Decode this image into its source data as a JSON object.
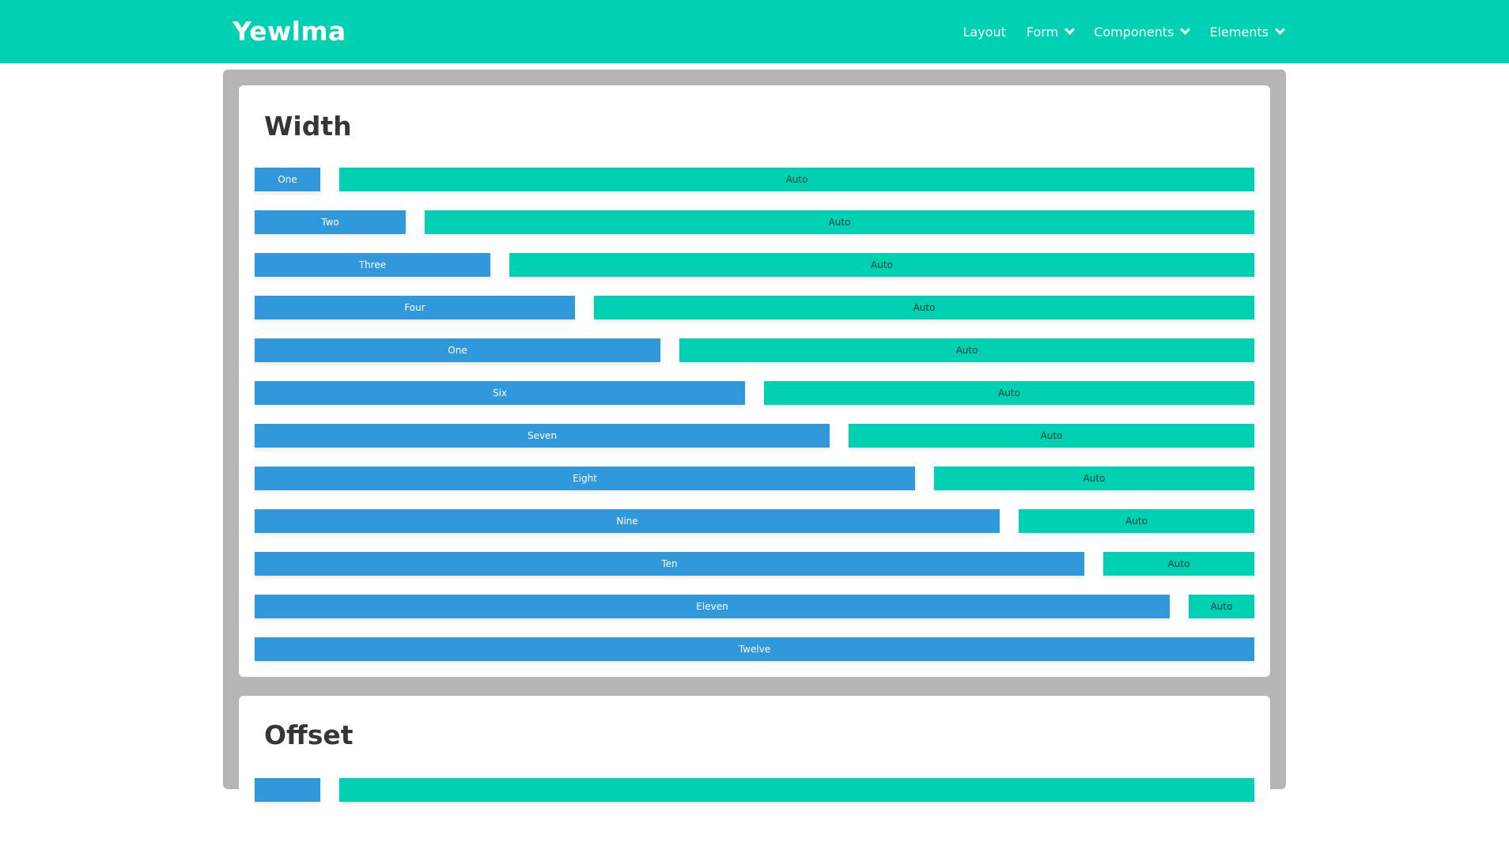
{
  "navbar": {
    "brand": "Yewlma",
    "items": [
      {
        "label": "Layout",
        "dropdown": false
      },
      {
        "label": "Form",
        "dropdown": true
      },
      {
        "label": "Components",
        "dropdown": true
      },
      {
        "label": "Elements",
        "dropdown": true
      }
    ]
  },
  "sections": {
    "width": {
      "title": "Width",
      "rows": [
        {
          "label": "One",
          "span": 1,
          "auto_label": "Auto"
        },
        {
          "label": "Two",
          "span": 2,
          "auto_label": "Auto"
        },
        {
          "label": "Three",
          "span": 3,
          "auto_label": "Auto"
        },
        {
          "label": "Four",
          "span": 4,
          "auto_label": "Auto"
        },
        {
          "label": "One",
          "span": 5,
          "auto_label": "Auto"
        },
        {
          "label": "Six",
          "span": 6,
          "auto_label": "Auto"
        },
        {
          "label": "Seven",
          "span": 7,
          "auto_label": "Auto"
        },
        {
          "label": "Eight",
          "span": 8,
          "auto_label": "Auto"
        },
        {
          "label": "Nine",
          "span": 9,
          "auto_label": "Auto"
        },
        {
          "label": "Ten",
          "span": 10,
          "auto_label": "Auto"
        },
        {
          "label": "Eleven",
          "span": 11,
          "auto_label": "Auto"
        },
        {
          "label": "Twelve",
          "span": 12,
          "auto_label": ""
        }
      ]
    },
    "offset": {
      "title": "Offset",
      "first_row_span": 1
    }
  },
  "colors": {
    "primary": "#00d1b2",
    "info": "#3298dc",
    "frame": "#b5b5b5",
    "title_text": "#363636"
  }
}
